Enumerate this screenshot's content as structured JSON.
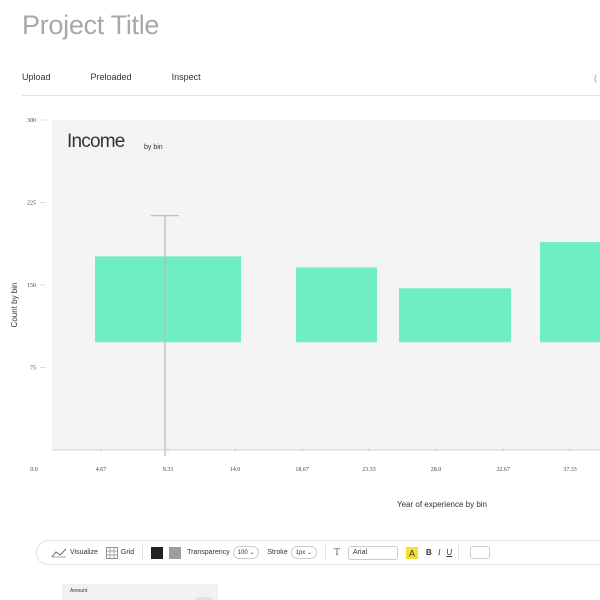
{
  "header": {
    "title": "Project Title"
  },
  "nav": {
    "tabs": [
      "Upload",
      "Preloaded",
      "Inspect"
    ],
    "extra": "("
  },
  "chart_data": {
    "type": "bar",
    "title": "Income",
    "subtitle": "by bin",
    "xlabel": "Year of experience by bin",
    "ylabel": "Count by bin",
    "y_ticks": [
      "300",
      "225",
      "150",
      "75"
    ],
    "x_ticks": [
      "0.0",
      "4.67",
      "9.33",
      "14.0",
      "18.67",
      "23.33",
      "28.0",
      "32.67",
      "37.33"
    ],
    "bins": [
      [
        4.67,
        9.33,
        14.0
      ],
      [
        18.67,
        23.33
      ],
      [
        28.0,
        32.67
      ],
      [
        37.33
      ]
    ],
    "values": [
      122,
      112,
      93,
      135
    ],
    "error_bar": {
      "x": 9.33,
      "y": 61
    },
    "ylim": [
      0,
      300
    ],
    "grid": false,
    "colors": {
      "bar": "#6deec5",
      "plot_bg": "#f3f4f3"
    }
  },
  "toolbar": {
    "visualize": "Visualize",
    "grid": "Grid",
    "transparency_label": "Transparency",
    "transparency_value": "100",
    "stroke_label": "Stroke",
    "stroke_value": "1px",
    "font_value": "Arial",
    "colors": {
      "dark": "#222222",
      "gray": "#9e9e9e",
      "highlight": "#f2e12e"
    }
  },
  "panel": {
    "title": "Amount"
  }
}
